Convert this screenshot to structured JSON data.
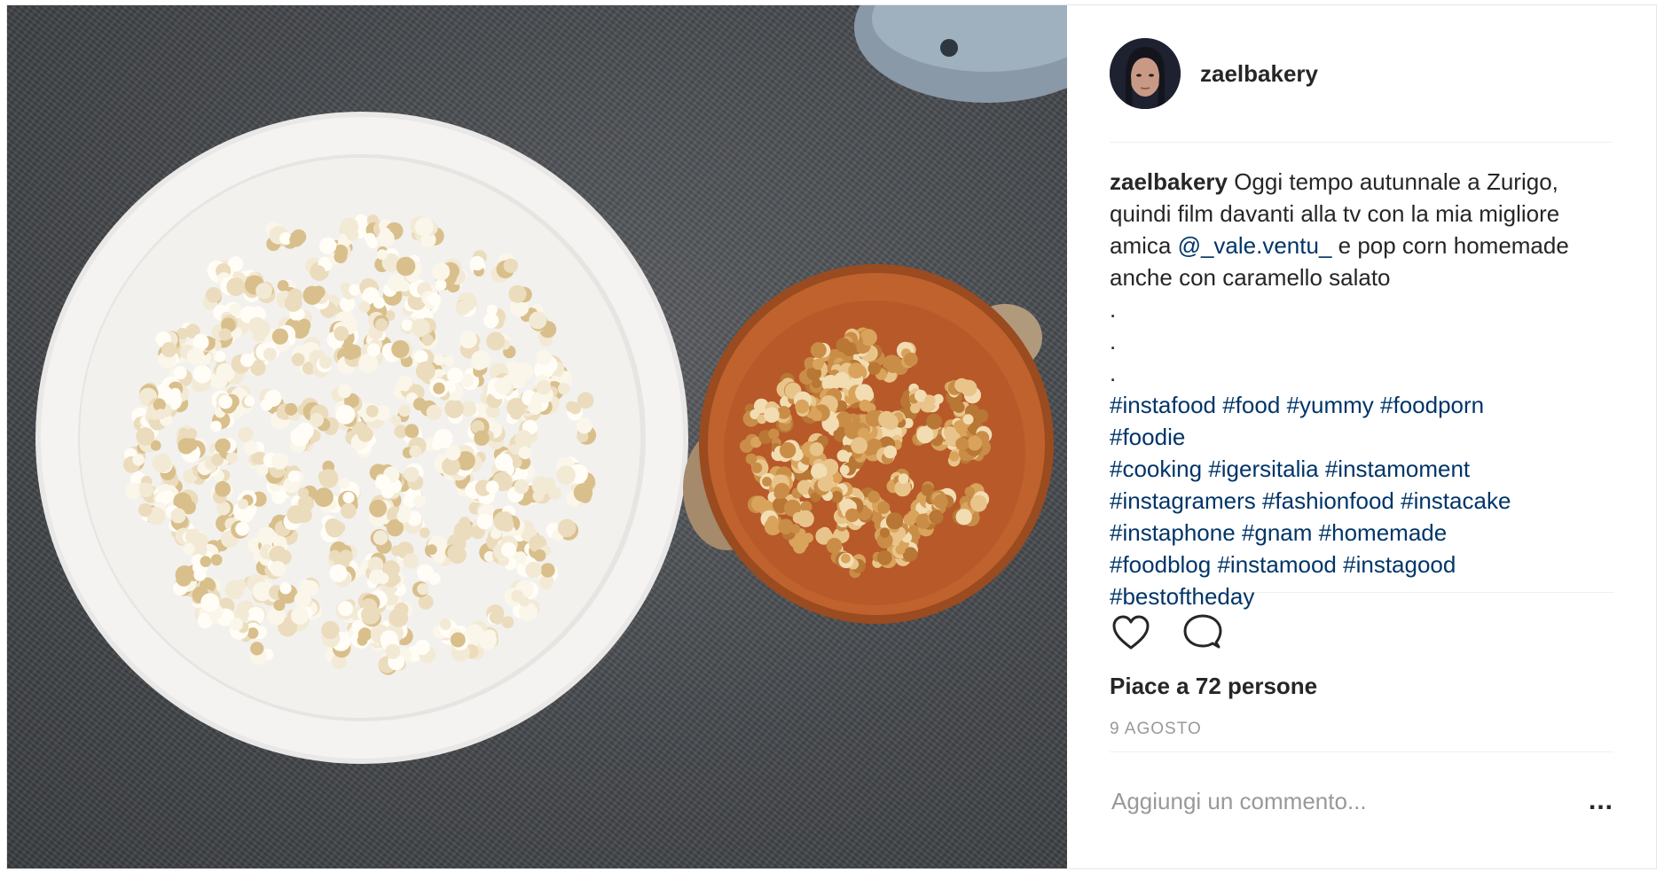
{
  "post": {
    "username": "zaelbakery",
    "avatar_alt": "zaelbakery",
    "caption": {
      "user": "zaelbakery",
      "text_before_mention": " Oggi tempo autunnale a Zurigo, quindi film davanti alla tv con la mia migliore amica ",
      "mention": "@_vale.ventu_",
      "text_after_mention": " e pop corn homemade anche con caramello salato",
      "dots": [
        ".",
        ".",
        "."
      ],
      "hashtag_lines": [
        [
          "#instafood",
          "#food",
          "#yummy",
          "#foodporn"
        ],
        [
          "#foodie"
        ],
        [
          "#cooking",
          "#igersitalia",
          "#instamoment"
        ],
        [
          "#instagramers",
          "#fashionfood",
          "#instacake"
        ],
        [
          "#instaphone",
          "#gnam",
          "#homemade"
        ],
        [
          "#foodblog",
          "#instamood",
          "#instagood"
        ],
        [
          "#bestoftheday"
        ]
      ]
    },
    "actions": {
      "like_icon": "heart-icon",
      "comment_icon": "comment-icon"
    },
    "likes_text": "Piace a 72 persone",
    "date": "9 AGOSTO",
    "comment_placeholder": "Aggiungi un commento...",
    "more_label": "..."
  },
  "colors": {
    "link": "#003569",
    "text": "#262626",
    "muted": "#999999",
    "countertop": "#46494d"
  }
}
